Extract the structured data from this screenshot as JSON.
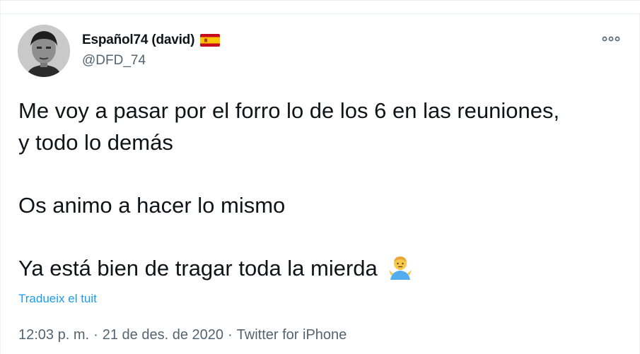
{
  "author": {
    "display_name": "Español74 (david)",
    "username": "@DFD_74",
    "flag_icon": "spain-flag-icon",
    "avatar": "profile-photo"
  },
  "tweet": {
    "lines": [
      "Me voy a pasar por el forro lo de los 6 en las reuniones,",
      "y todo lo demás",
      "",
      "Os animo a hacer lo mismo",
      "",
      "Ya está bien de tragar toda la mierda"
    ],
    "emoji": "person-shrugging-emoji"
  },
  "translate_label": "Tradueix el tuit",
  "meta": {
    "time": "12:03 p. m.",
    "separator_1": "·",
    "date": "21 de des. de 2020",
    "separator_2": "·",
    "source": "Twitter for iPhone"
  },
  "colors": {
    "text": "#0f1419",
    "secondary": "#536471",
    "link": "#1d9bf0"
  },
  "icons": {
    "more": "more-options-icon"
  }
}
